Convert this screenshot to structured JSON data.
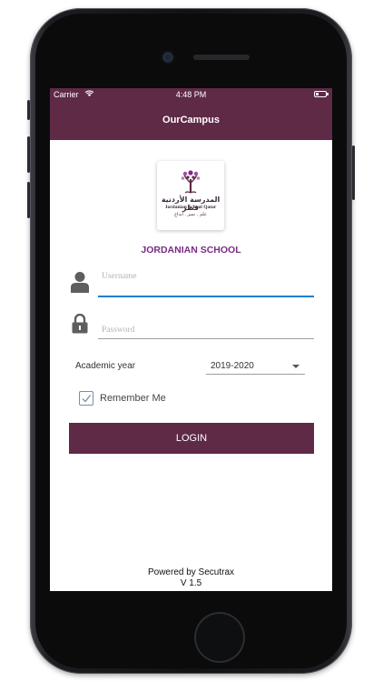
{
  "status_bar": {
    "carrier": "Carrier",
    "time": "4:48 PM"
  },
  "nav": {
    "title": "OurCampus"
  },
  "logo": {
    "arabic_name": "المدرسة الأردنية قطر",
    "english_name": "Jordanian School Qatar",
    "motto": "علم . تميز . ابداع"
  },
  "school_name": "JORDANIAN SCHOOL",
  "form": {
    "username": {
      "placeholder": "Username",
      "value": ""
    },
    "password": {
      "placeholder": "Password",
      "value": ""
    },
    "academic_year_label": "Academic year",
    "academic_year_value": "2019-2020",
    "remember_me_label": "Remember Me",
    "remember_me_checked": true,
    "login_label": "LOGIN"
  },
  "footer": {
    "powered_by": "Powered by Secutrax",
    "version": "V 1.5"
  },
  "colors": {
    "brand": "#5f2a46",
    "accent": "#1f7fd0",
    "school_name": "#7a2c83"
  }
}
